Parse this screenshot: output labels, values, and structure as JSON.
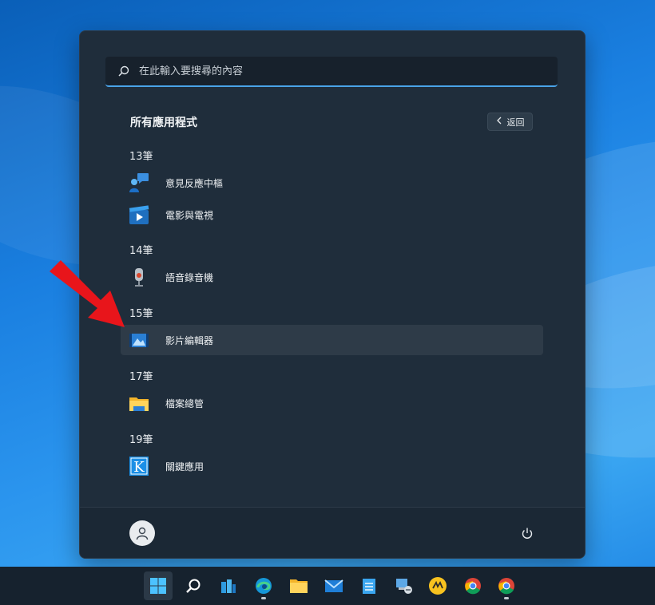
{
  "search": {
    "placeholder": "在此輸入要搜尋的內容"
  },
  "all_apps": {
    "title": "所有應用程式",
    "back_label": "返回"
  },
  "groups": [
    {
      "letter": "13筆",
      "apps": [
        {
          "label": "意見反應中樞",
          "icon": "feedback-hub-icon"
        },
        {
          "label": "電影與電視",
          "icon": "movies-tv-icon"
        }
      ]
    },
    {
      "letter": "14筆",
      "apps": [
        {
          "label": "語音錄音機",
          "icon": "voice-recorder-icon"
        }
      ]
    },
    {
      "letter": "15筆",
      "apps": [
        {
          "label": "影片編輯器",
          "icon": "video-editor-icon",
          "highlighted": true
        }
      ]
    },
    {
      "letter": "17筆",
      "apps": [
        {
          "label": "檔案總管",
          "icon": "file-explorer-icon"
        }
      ]
    },
    {
      "letter": "19筆",
      "apps": [
        {
          "label": "關鍵應用",
          "icon": "k-app-icon"
        }
      ]
    }
  ],
  "footer": {
    "user_icon": "user-avatar-icon",
    "power_icon": "power-icon"
  },
  "taskbar": {
    "icons": [
      "start-icon",
      "search-icon",
      "widgets-icon",
      "edge-icon",
      "file-explorer-icon",
      "mail-icon",
      "notepad-icon",
      "network-icon",
      "app-icon",
      "chrome-icon",
      "chrome-alt-icon"
    ]
  },
  "colors": {
    "accent": "#4aa3e8",
    "menu_bg": "#1f2d3b",
    "highlight": "#2e3b48",
    "arrow": "#e8151b"
  }
}
